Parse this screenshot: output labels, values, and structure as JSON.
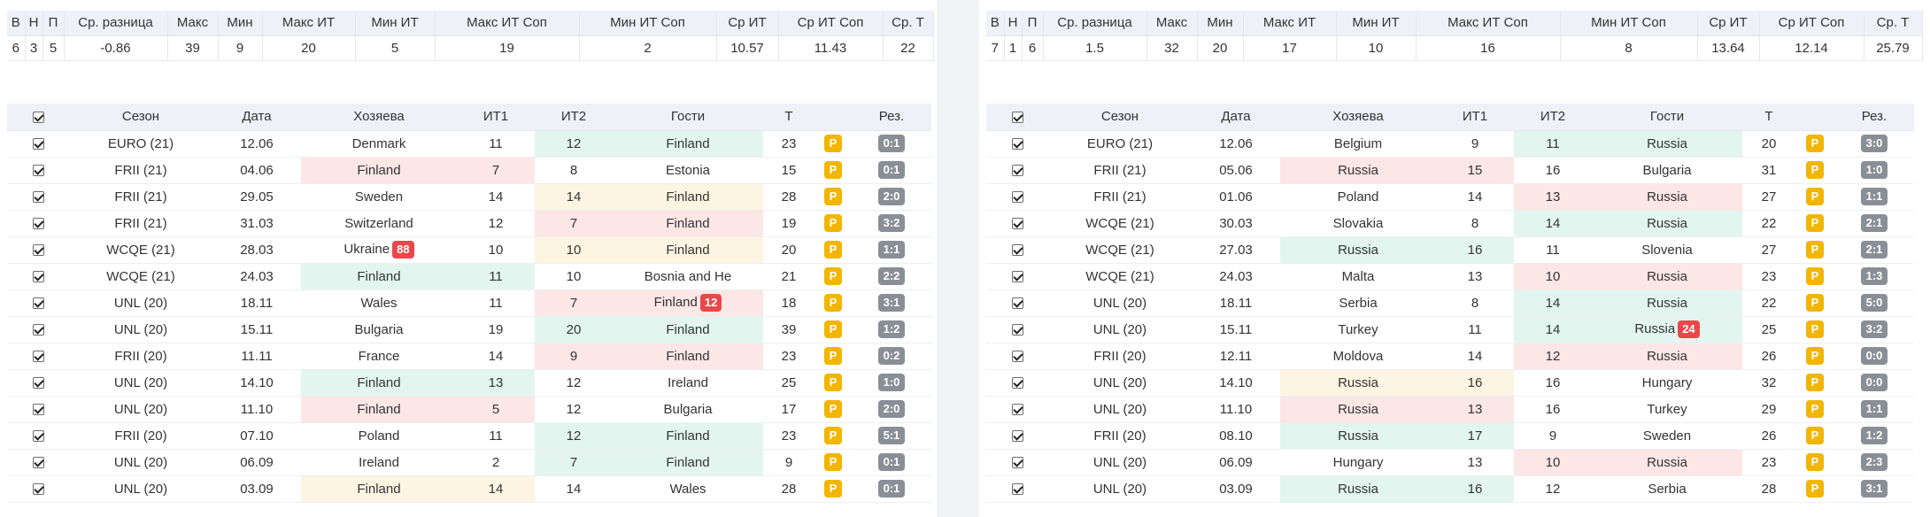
{
  "colors": {
    "header_bg": "#eef1f8",
    "highlight_green": "#e3f5ef",
    "highlight_red": "#fde6e6",
    "highlight_yellow": "#fdf5e2",
    "p_badge": "#f2b500",
    "result_badge": "#8a8f97",
    "card_badge": "#e9474b"
  },
  "icons": {
    "row_checkbox": "checkbox-checked-icon"
  },
  "summary_headers": [
    "В",
    "Н",
    "П",
    "Ср. разница",
    "Макс",
    "Мин",
    "Макс ИТ",
    "Мин ИТ",
    "Макс ИТ Соп",
    "Мин ИТ Соп",
    "Ср ИТ",
    "Ср ИТ Соп",
    "Ср. Т"
  ],
  "match_headers": [
    "Сезон",
    "Дата",
    "Хозяева",
    "ИТ1",
    "ИТ2",
    "Гости",
    "Т",
    "Рез."
  ],
  "left": {
    "summary": [
      "6",
      "3",
      "5",
      "-0.86",
      "39",
      "9",
      "20",
      "5",
      "19",
      "2",
      "10.57",
      "11.43",
      "22"
    ],
    "rows": [
      {
        "season": "EURO (21)",
        "date": "12.06",
        "home": "Denmark",
        "home_card": "",
        "it1": "11",
        "it2": "12",
        "away": "Finland",
        "away_card": "",
        "total": "23",
        "p": "P",
        "result": "0:1",
        "hl_home": "",
        "hl_it1": "",
        "hl_it2": "green",
        "hl_away": "green"
      },
      {
        "season": "FRII (21)",
        "date": "04.06",
        "home": "Finland",
        "home_card": "",
        "it1": "7",
        "it2": "8",
        "away": "Estonia",
        "away_card": "",
        "total": "15",
        "p": "P",
        "result": "0:1",
        "hl_home": "red",
        "hl_it1": "red",
        "hl_it2": "",
        "hl_away": ""
      },
      {
        "season": "FRII (21)",
        "date": "29.05",
        "home": "Sweden",
        "home_card": "",
        "it1": "14",
        "it2": "14",
        "away": "Finland",
        "away_card": "",
        "total": "28",
        "p": "P",
        "result": "2:0",
        "hl_home": "",
        "hl_it1": "",
        "hl_it2": "yellow",
        "hl_away": "yellow"
      },
      {
        "season": "FRII (21)",
        "date": "31.03",
        "home": "Switzerland",
        "home_card": "",
        "it1": "12",
        "it2": "7",
        "away": "Finland",
        "away_card": "",
        "total": "19",
        "p": "P",
        "result": "3:2",
        "hl_home": "",
        "hl_it1": "",
        "hl_it2": "red",
        "hl_away": "red"
      },
      {
        "season": "WCQE (21)",
        "date": "28.03",
        "home": "Ukraine",
        "home_card": "88",
        "it1": "10",
        "it2": "10",
        "away": "Finland",
        "away_card": "",
        "total": "20",
        "p": "P",
        "result": "1:1",
        "hl_home": "",
        "hl_it1": "",
        "hl_it2": "yellow",
        "hl_away": "yellow"
      },
      {
        "season": "WCQE (21)",
        "date": "24.03",
        "home": "Finland",
        "home_card": "",
        "it1": "11",
        "it2": "10",
        "away": "Bosnia and He",
        "away_card": "",
        "total": "21",
        "p": "P",
        "result": "2:2",
        "hl_home": "green",
        "hl_it1": "green",
        "hl_it2": "",
        "hl_away": ""
      },
      {
        "season": "UNL (20)",
        "date": "18.11",
        "home": "Wales",
        "home_card": "",
        "it1": "11",
        "it2": "7",
        "away": "Finland",
        "away_card": "12",
        "total": "18",
        "p": "P",
        "result": "3:1",
        "hl_home": "",
        "hl_it1": "",
        "hl_it2": "red",
        "hl_away": "red"
      },
      {
        "season": "UNL (20)",
        "date": "15.11",
        "home": "Bulgaria",
        "home_card": "",
        "it1": "19",
        "it2": "20",
        "away": "Finland",
        "away_card": "",
        "total": "39",
        "p": "P",
        "result": "1:2",
        "hl_home": "",
        "hl_it1": "",
        "hl_it2": "green",
        "hl_away": "green"
      },
      {
        "season": "FRII (20)",
        "date": "11.11",
        "home": "France",
        "home_card": "",
        "it1": "14",
        "it2": "9",
        "away": "Finland",
        "away_card": "",
        "total": "23",
        "p": "P",
        "result": "0:2",
        "hl_home": "",
        "hl_it1": "",
        "hl_it2": "red",
        "hl_away": "red"
      },
      {
        "season": "UNL (20)",
        "date": "14.10",
        "home": "Finland",
        "home_card": "",
        "it1": "13",
        "it2": "12",
        "away": "Ireland",
        "away_card": "",
        "total": "25",
        "p": "P",
        "result": "1:0",
        "hl_home": "green",
        "hl_it1": "green",
        "hl_it2": "",
        "hl_away": ""
      },
      {
        "season": "UNL (20)",
        "date": "11.10",
        "home": "Finland",
        "home_card": "",
        "it1": "5",
        "it2": "12",
        "away": "Bulgaria",
        "away_card": "",
        "total": "17",
        "p": "P",
        "result": "2:0",
        "hl_home": "red",
        "hl_it1": "red",
        "hl_it2": "",
        "hl_away": ""
      },
      {
        "season": "FRII (20)",
        "date": "07.10",
        "home": "Poland",
        "home_card": "",
        "it1": "11",
        "it2": "12",
        "away": "Finland",
        "away_card": "",
        "total": "23",
        "p": "P",
        "result": "5:1",
        "hl_home": "",
        "hl_it1": "",
        "hl_it2": "green",
        "hl_away": "green"
      },
      {
        "season": "UNL (20)",
        "date": "06.09",
        "home": "Ireland",
        "home_card": "",
        "it1": "2",
        "it2": "7",
        "away": "Finland",
        "away_card": "",
        "total": "9",
        "p": "P",
        "result": "0:1",
        "hl_home": "",
        "hl_it1": "",
        "hl_it2": "green",
        "hl_away": "green"
      },
      {
        "season": "UNL (20)",
        "date": "03.09",
        "home": "Finland",
        "home_card": "",
        "it1": "14",
        "it2": "14",
        "away": "Wales",
        "away_card": "",
        "total": "28",
        "p": "P",
        "result": "0:1",
        "hl_home": "yellow",
        "hl_it1": "yellow",
        "hl_it2": "",
        "hl_away": ""
      }
    ]
  },
  "right": {
    "summary": [
      "7",
      "1",
      "6",
      "1.5",
      "32",
      "20",
      "17",
      "10",
      "16",
      "8",
      "13.64",
      "12.14",
      "25.79"
    ],
    "rows": [
      {
        "season": "EURO (21)",
        "date": "12.06",
        "home": "Belgium",
        "home_card": "",
        "it1": "9",
        "it2": "11",
        "away": "Russia",
        "away_card": "",
        "total": "20",
        "p": "P",
        "result": "3:0",
        "hl_home": "",
        "hl_it1": "",
        "hl_it2": "green",
        "hl_away": "green"
      },
      {
        "season": "FRII (21)",
        "date": "05.06",
        "home": "Russia",
        "home_card": "",
        "it1": "15",
        "it2": "16",
        "away": "Bulgaria",
        "away_card": "",
        "total": "31",
        "p": "P",
        "result": "1:0",
        "hl_home": "red",
        "hl_it1": "red",
        "hl_it2": "",
        "hl_away": ""
      },
      {
        "season": "FRII (21)",
        "date": "01.06",
        "home": "Poland",
        "home_card": "",
        "it1": "14",
        "it2": "13",
        "away": "Russia",
        "away_card": "",
        "total": "27",
        "p": "P",
        "result": "1:1",
        "hl_home": "",
        "hl_it1": "",
        "hl_it2": "red",
        "hl_away": "red"
      },
      {
        "season": "WCQE (21)",
        "date": "30.03",
        "home": "Slovakia",
        "home_card": "",
        "it1": "8",
        "it2": "14",
        "away": "Russia",
        "away_card": "",
        "total": "22",
        "p": "P",
        "result": "2:1",
        "hl_home": "",
        "hl_it1": "",
        "hl_it2": "green",
        "hl_away": "green"
      },
      {
        "season": "WCQE (21)",
        "date": "27.03",
        "home": "Russia",
        "home_card": "",
        "it1": "16",
        "it2": "11",
        "away": "Slovenia",
        "away_card": "",
        "total": "27",
        "p": "P",
        "result": "2:1",
        "hl_home": "green",
        "hl_it1": "green",
        "hl_it2": "",
        "hl_away": ""
      },
      {
        "season": "WCQE (21)",
        "date": "24.03",
        "home": "Malta",
        "home_card": "",
        "it1": "13",
        "it2": "10",
        "away": "Russia",
        "away_card": "",
        "total": "23",
        "p": "P",
        "result": "1:3",
        "hl_home": "",
        "hl_it1": "",
        "hl_it2": "red",
        "hl_away": "red"
      },
      {
        "season": "UNL (20)",
        "date": "18.11",
        "home": "Serbia",
        "home_card": "",
        "it1": "8",
        "it2": "14",
        "away": "Russia",
        "away_card": "",
        "total": "22",
        "p": "P",
        "result": "5:0",
        "hl_home": "",
        "hl_it1": "",
        "hl_it2": "green",
        "hl_away": "green"
      },
      {
        "season": "UNL (20)",
        "date": "15.11",
        "home": "Turkey",
        "home_card": "",
        "it1": "11",
        "it2": "14",
        "away": "Russia",
        "away_card": "24",
        "total": "25",
        "p": "P",
        "result": "3:2",
        "hl_home": "",
        "hl_it1": "",
        "hl_it2": "green",
        "hl_away": "green"
      },
      {
        "season": "FRII (20)",
        "date": "12.11",
        "home": "Moldova",
        "home_card": "",
        "it1": "14",
        "it2": "12",
        "away": "Russia",
        "away_card": "",
        "total": "26",
        "p": "P",
        "result": "0:0",
        "hl_home": "",
        "hl_it1": "",
        "hl_it2": "red",
        "hl_away": "red"
      },
      {
        "season": "UNL (20)",
        "date": "14.10",
        "home": "Russia",
        "home_card": "",
        "it1": "16",
        "it2": "16",
        "away": "Hungary",
        "away_card": "",
        "total": "32",
        "p": "P",
        "result": "0:0",
        "hl_home": "yellow",
        "hl_it1": "yellow",
        "hl_it2": "",
        "hl_away": ""
      },
      {
        "season": "UNL (20)",
        "date": "11.10",
        "home": "Russia",
        "home_card": "",
        "it1": "13",
        "it2": "16",
        "away": "Turkey",
        "away_card": "",
        "total": "29",
        "p": "P",
        "result": "1:1",
        "hl_home": "red",
        "hl_it1": "red",
        "hl_it2": "",
        "hl_away": ""
      },
      {
        "season": "FRII (20)",
        "date": "08.10",
        "home": "Russia",
        "home_card": "",
        "it1": "17",
        "it2": "9",
        "away": "Sweden",
        "away_card": "",
        "total": "26",
        "p": "P",
        "result": "1:2",
        "hl_home": "green",
        "hl_it1": "green",
        "hl_it2": "",
        "hl_away": ""
      },
      {
        "season": "UNL (20)",
        "date": "06.09",
        "home": "Hungary",
        "home_card": "",
        "it1": "13",
        "it2": "10",
        "away": "Russia",
        "away_card": "",
        "total": "23",
        "p": "P",
        "result": "2:3",
        "hl_home": "",
        "hl_it1": "",
        "hl_it2": "red",
        "hl_away": "red"
      },
      {
        "season": "UNL (20)",
        "date": "03.09",
        "home": "Russia",
        "home_card": "",
        "it1": "16",
        "it2": "12",
        "away": "Serbia",
        "away_card": "",
        "total": "28",
        "p": "P",
        "result": "3:1",
        "hl_home": "green",
        "hl_it1": "green",
        "hl_it2": "",
        "hl_away": ""
      }
    ]
  }
}
